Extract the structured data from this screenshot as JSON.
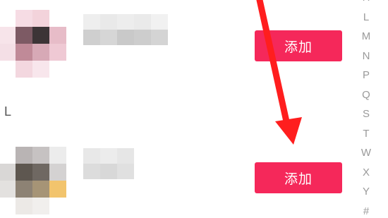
{
  "contacts": {
    "rows": [
      {
        "add_label": "添加"
      },
      {
        "add_label": "添加"
      }
    ]
  },
  "section_header": "L",
  "index_bar": {
    "letters": [
      "H",
      "L",
      "M",
      "N",
      "P",
      "Q",
      "S",
      "T",
      "W",
      "X",
      "Y",
      "#"
    ]
  },
  "colors": {
    "add_button": "#f5285a",
    "add_button_text": "#ffffff",
    "annotation_arrow": "#ff1e1e",
    "index_text": "#9a9a9a"
  }
}
